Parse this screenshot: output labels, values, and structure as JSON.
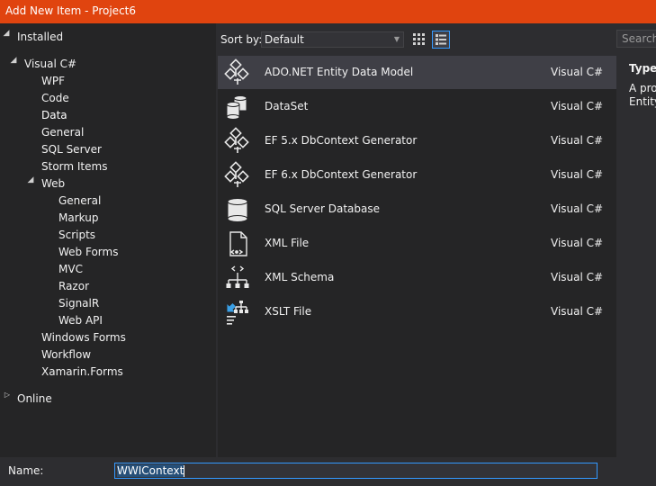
{
  "window": {
    "title": "Add New Item - Project6"
  },
  "tree": {
    "installed": "Installed",
    "visual_csharp": "Visual C#",
    "children": [
      "WPF",
      "Code",
      "Data",
      "General",
      "SQL Server",
      "Storm Items"
    ],
    "web": "Web",
    "web_children": [
      "General",
      "Markup",
      "Scripts",
      "Web Forms",
      "MVC",
      "Razor",
      "SignalR",
      "Web API"
    ],
    "after_web": [
      "Windows Forms",
      "Workflow",
      "Xamarin.Forms"
    ],
    "online": "Online",
    "selected": "Data"
  },
  "sort": {
    "label": "Sort by:",
    "value": "Default"
  },
  "search": {
    "placeholder": "Search"
  },
  "items": [
    {
      "name": "ADO.NET Entity Data Model",
      "lang": "Visual C#",
      "icon": "entity-model-icon",
      "selected": true
    },
    {
      "name": "DataSet",
      "lang": "Visual C#",
      "icon": "dataset-icon",
      "selected": false
    },
    {
      "name": "EF 5.x DbContext Generator",
      "lang": "Visual C#",
      "icon": "ef-generator-icon",
      "selected": false
    },
    {
      "name": "EF 6.x DbContext Generator",
      "lang": "Visual C#",
      "icon": "ef-generator-icon",
      "selected": false
    },
    {
      "name": "SQL Server Database",
      "lang": "Visual C#",
      "icon": "database-icon",
      "selected": false
    },
    {
      "name": "XML File",
      "lang": "Visual C#",
      "icon": "xml-file-icon",
      "selected": false
    },
    {
      "name": "XML Schema",
      "lang": "Visual C#",
      "icon": "xml-schema-icon",
      "selected": false
    },
    {
      "name": "XSLT File",
      "lang": "Visual C#",
      "icon": "xslt-file-icon",
      "selected": false
    }
  ],
  "details": {
    "type_label": "Type:",
    "description_line1": "A proj",
    "description_line2": "Entity"
  },
  "name_field": {
    "label": "Name:",
    "value": "WWIContext"
  },
  "colors": {
    "accent": "#e0440f",
    "selection": "#3f3f46",
    "focus": "#3399ff"
  }
}
